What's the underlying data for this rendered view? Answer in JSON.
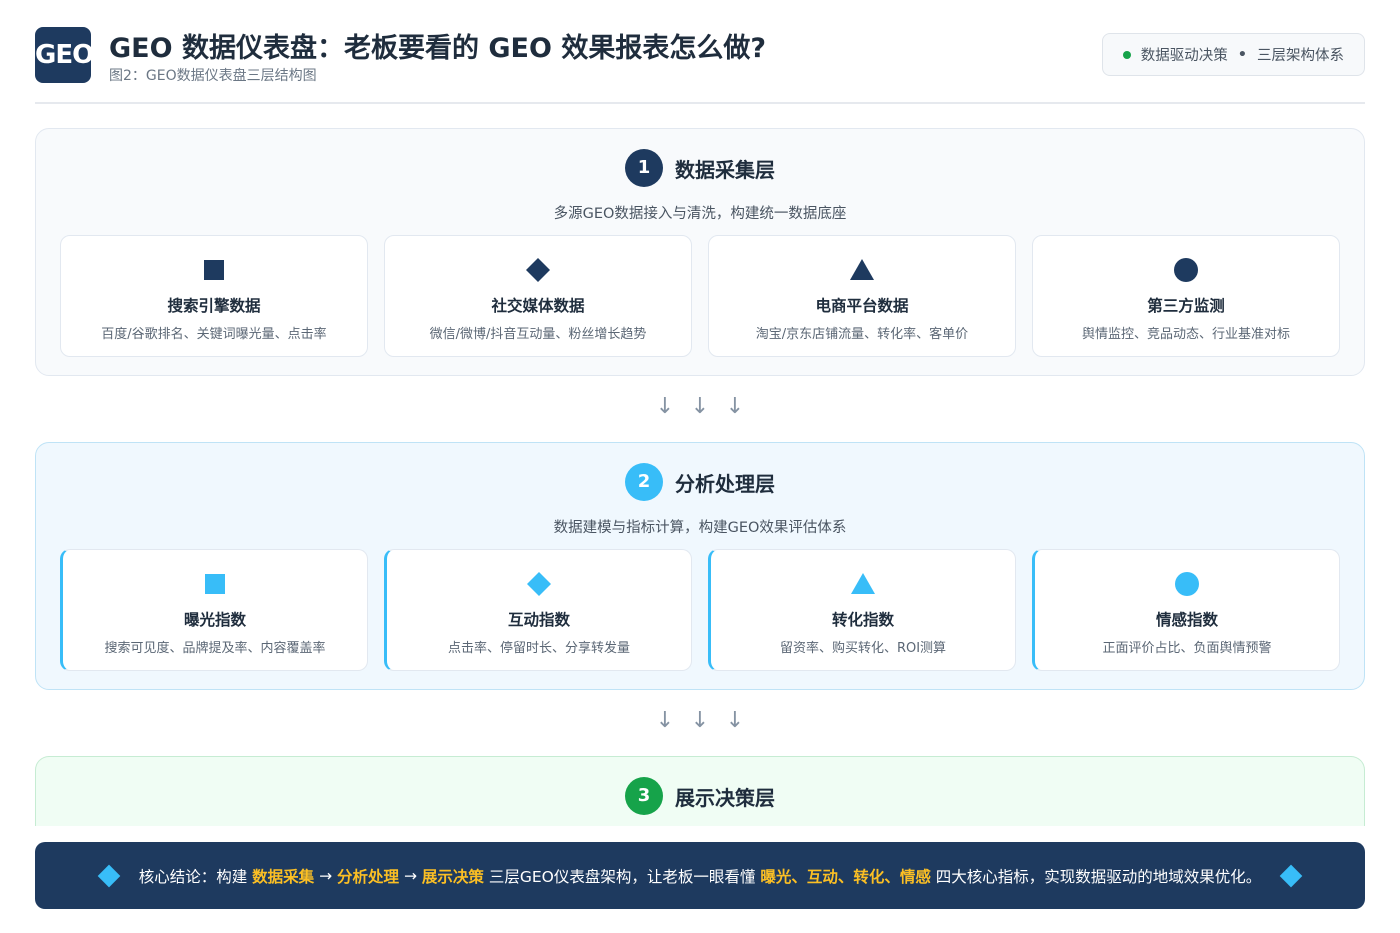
{
  "header": {
    "logo": "GEO",
    "title": "GEO 数据仪表盘：老板要看的 GEO 效果报表怎么做?",
    "subtitle": "图2：GEO数据仪表盘三层结构图",
    "badge_left": "数据驱动决策",
    "badge_sep": "•",
    "badge_right": "三层架构体系"
  },
  "layers": [
    {
      "num": "1",
      "title": "数据采集层",
      "desc": "多源GEO数据接入与清洗，构建统一数据底座",
      "color": "#1e3a5f",
      "cards": [
        {
          "icon": "square-icon",
          "title": "搜索引擎数据",
          "desc": "百度/谷歌排名、关键词曝光量、点击率"
        },
        {
          "icon": "diamond-icon",
          "title": "社交媒体数据",
          "desc": "微信/微博/抖音互动量、粉丝增长趋势"
        },
        {
          "icon": "triangle-icon",
          "title": "电商平台数据",
          "desc": "淘宝/京东店铺流量、转化率、客单价"
        },
        {
          "icon": "circle-icon",
          "title": "第三方监测",
          "desc": "舆情监控、竞品动态、行业基准对标"
        }
      ]
    },
    {
      "num": "2",
      "title": "分析处理层",
      "desc": "数据建模与指标计算，构建GEO效果评估体系",
      "color": "#38bdf8",
      "cards": [
        {
          "icon": "square-icon",
          "title": "曝光指数",
          "desc": "搜索可见度、品牌提及率、内容覆盖率"
        },
        {
          "icon": "diamond-icon",
          "title": "互动指数",
          "desc": "点击率、停留时长、分享转发量"
        },
        {
          "icon": "triangle-icon",
          "title": "转化指数",
          "desc": "留资率、购买转化、ROI测算"
        },
        {
          "icon": "circle-icon",
          "title": "情感指数",
          "desc": "正面评价占比、负面舆情预警"
        }
      ]
    },
    {
      "num": "3",
      "title": "展示决策层",
      "color": "#16a34a"
    }
  ],
  "arrow_glyph": "↓",
  "conclusion": {
    "prefix": "核心结论：构建",
    "step1": "数据采集",
    "arrow": "→",
    "step2": "分析处理",
    "step3": "展示决策",
    "middle": "三层GEO仪表盘架构，让老板一眼看懂",
    "metrics": "曝光、互动、转化、情感",
    "suffix": "四大核心指标，实现数据驱动的地域效果优化。"
  }
}
